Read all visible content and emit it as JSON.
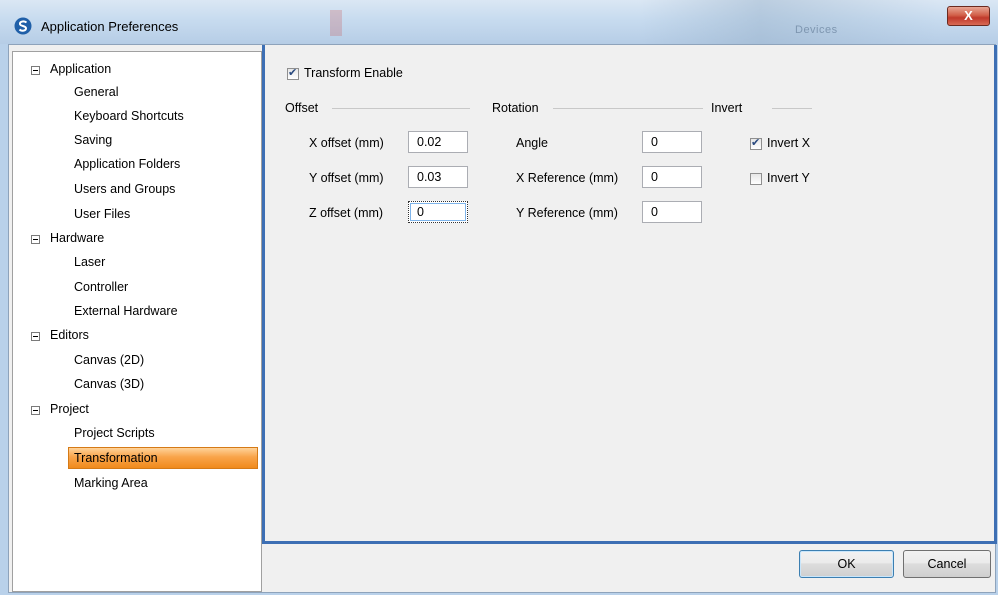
{
  "window": {
    "title": "Application Preferences",
    "close_label": "X",
    "background_hint": "Devices"
  },
  "tree": {
    "groups": [
      {
        "label": "Application",
        "items": [
          "General",
          "Keyboard Shortcuts",
          "Saving",
          "Application Folders",
          "Users and Groups",
          "User Files"
        ]
      },
      {
        "label": "Hardware",
        "items": [
          "Laser",
          "Controller",
          "External Hardware"
        ]
      },
      {
        "label": "Editors",
        "items": [
          "Canvas (2D)",
          "Canvas (3D)"
        ]
      },
      {
        "label": "Project",
        "items": [
          "Project Scripts",
          "Transformation",
          "Marking Area"
        ]
      }
    ],
    "selected": "Transformation"
  },
  "transform": {
    "enable_label": "Transform Enable",
    "enabled": true
  },
  "offset": {
    "header": "Offset",
    "x_label": "X offset (mm)",
    "x_value": "0.02",
    "y_label": "Y offset (mm)",
    "y_value": "0.03",
    "z_label": "Z offset (mm)",
    "z_value": "0"
  },
  "rotation": {
    "header": "Rotation",
    "angle_label": "Angle",
    "angle_value": "0",
    "xref_label": "X Reference (mm)",
    "xref_value": "0",
    "yref_label": "Y Reference (mm)",
    "yref_value": "0"
  },
  "invert": {
    "header": "Invert",
    "x_label": "Invert X",
    "x_checked": true,
    "y_label": "Invert Y",
    "y_checked": false
  },
  "buttons": {
    "ok": "OK",
    "cancel": "Cancel"
  },
  "colors": {
    "selection": "#f9a44a",
    "panel_border": "#3d6fb4",
    "close_button": "#c0392b"
  }
}
